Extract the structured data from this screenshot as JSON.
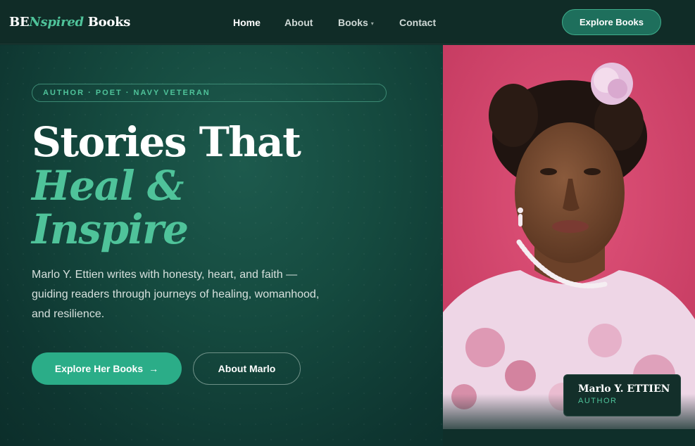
{
  "nav": {
    "logo_prefix": "BE",
    "logo_italic": "Nspired",
    "logo_suffix": "Books",
    "links": [
      {
        "label": "Home"
      },
      {
        "label": "About"
      },
      {
        "label": "Books",
        "caret": "▾"
      },
      {
        "label": "Contact"
      }
    ],
    "cta_label": "Explore Books"
  },
  "hero": {
    "tag": "AUTHOR · POET · NAVY VETERAN",
    "headline_line1": "Stories That",
    "headline_line2": "Heal &",
    "headline_line3": "Inspire",
    "intro": "Marlo Y. Ettien writes with honesty, heart, and faith — guiding readers through journeys of healing, womanhood, and resilience.",
    "primary_button": "Explore Her Books",
    "primary_arrow": "→",
    "secondary_button": "About Marlo"
  },
  "portrait": {
    "name": "Marlo Y. ETTIEN",
    "role": "AUTHOR"
  },
  "colors": {
    "background": "#0f2f2a",
    "accent_green": "#4fc39a",
    "button_green": "#2bad88",
    "photo_backdrop": "#d8476e"
  },
  "icons": [
    "chevron-down-icon",
    "arrow-right-icon"
  ]
}
